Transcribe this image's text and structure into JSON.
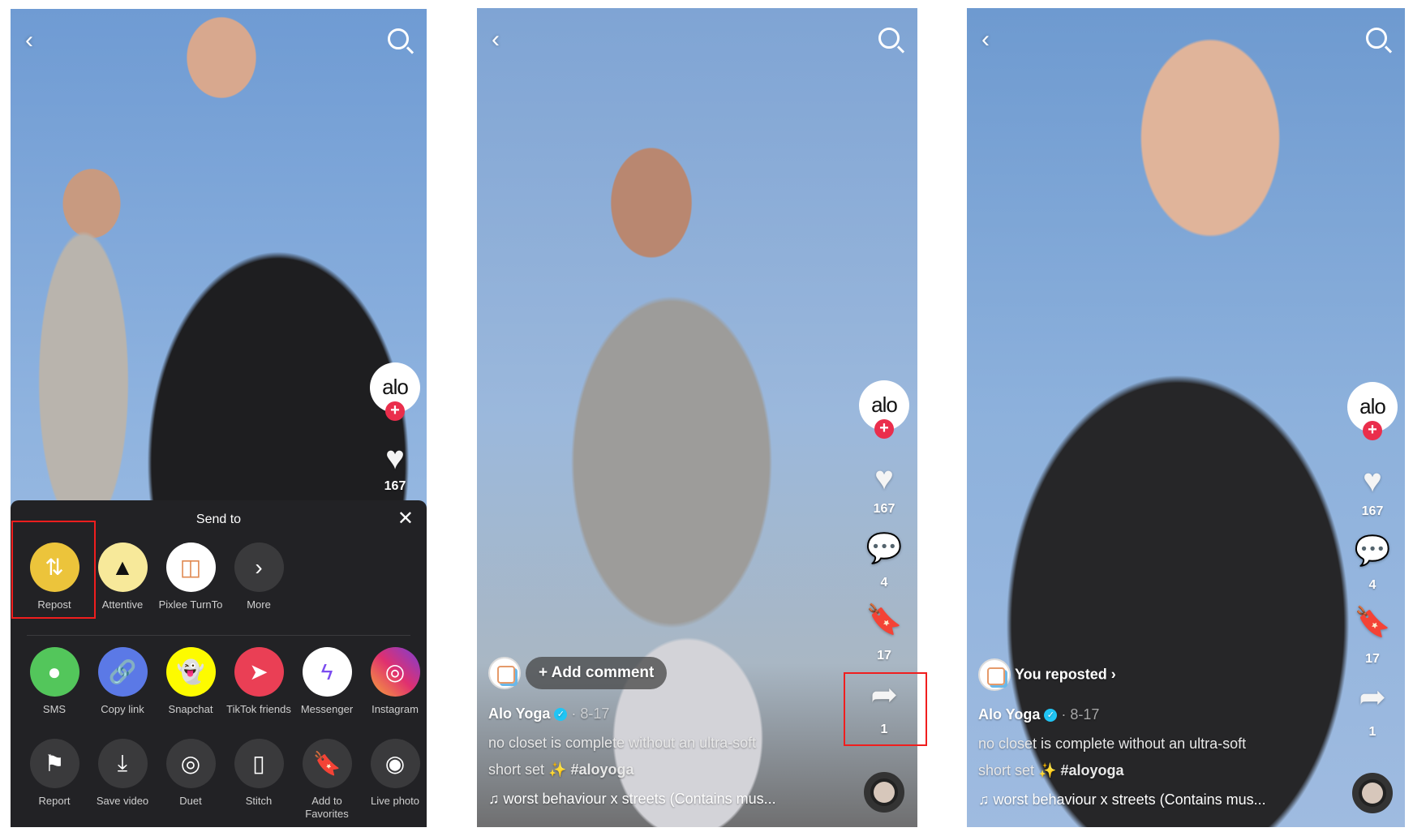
{
  "panel1": {
    "likes": "167",
    "avatar_text": "alo",
    "share_sheet": {
      "title": "Send to",
      "row1": [
        {
          "label": "Repost",
          "icon": "repost-icon",
          "color": "#ecc43b"
        },
        {
          "label": "Attentive",
          "icon": "attentive-icon",
          "color": "#f7e99a"
        },
        {
          "label": "Pixlee TurnTo",
          "icon": "pixlee-icon",
          "color": "#ffffff"
        },
        {
          "label": "More",
          "icon": "chevron-right-icon",
          "color": "#3a3a3c"
        }
      ],
      "row2": [
        {
          "label": "SMS",
          "icon": "sms-icon",
          "color": "#53c65b"
        },
        {
          "label": "Copy link",
          "icon": "link-icon",
          "color": "#5b79e6"
        },
        {
          "label": "Snapchat",
          "icon": "snapchat-icon",
          "color": "#fdfb00"
        },
        {
          "label": "TikTok friends",
          "icon": "send-icon",
          "color": "#ea3f55"
        },
        {
          "label": "Messenger",
          "icon": "messenger-icon",
          "color": "#ffffff"
        },
        {
          "label": "Instagram",
          "icon": "instagram-icon",
          "color": "#d9367a"
        }
      ],
      "row3": [
        {
          "label": "Report",
          "icon": "flag-icon"
        },
        {
          "label": "Save video",
          "icon": "download-icon"
        },
        {
          "label": "Duet",
          "icon": "duet-icon"
        },
        {
          "label": "Stitch",
          "icon": "stitch-icon"
        },
        {
          "label": "Add to Favorites",
          "icon": "bookmark-icon"
        },
        {
          "label": "Live photo",
          "icon": "live-photo-icon"
        }
      ]
    }
  },
  "panel2": {
    "avatar_text": "alo",
    "likes": "167",
    "comments": "4",
    "favorites": "17",
    "shares": "1",
    "add_comment": "+ Add comment",
    "author": "Alo Yoga",
    "date": "· 8-17",
    "caption_line1": "no closet is complete without an ultra-soft",
    "caption_line2": "short set ✨",
    "hashtag": "#aloyoga",
    "music": "♫ worst behaviour x streets (Contains mus..."
  },
  "panel3": {
    "avatar_text": "alo",
    "likes": "167",
    "comments": "4",
    "favorites": "17",
    "shares": "1",
    "reposted": "You reposted ›",
    "author": "Alo Yoga",
    "date": "· 8-17",
    "caption_line1": "no closet is complete without an ultra-soft",
    "caption_line2": "short set ✨",
    "hashtag": "#aloyoga",
    "music": "♫ worst behaviour x streets (Contains mus..."
  },
  "highlight_color": "#f01e1e"
}
